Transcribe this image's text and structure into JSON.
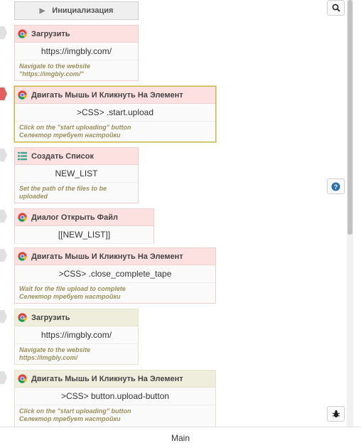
{
  "init_label": "Инициализация",
  "footer_tab": "Main",
  "blocks": [
    {
      "title": "Загрузить",
      "value": "https://imgbly.com/",
      "note": [
        "Navigate to the website",
        "\"https://imgbly.com/\""
      ]
    },
    {
      "title": "Двигать Мышь И Кликнуть На Элемент",
      "value": ">CSS> .start.upload",
      "note": [
        "Click on the \"start uploading\" button",
        "Селектор требует настройки"
      ]
    },
    {
      "title": "Создать Список",
      "value": "NEW_LIST",
      "note": [
        "Set the path of the files to be",
        "uploaded"
      ]
    },
    {
      "title": "Диалог Открыть Файл",
      "value": "[[NEW_LIST]]",
      "note": []
    },
    {
      "title": "Двигать Мышь И Кликнуть На Элемент",
      "value": ">CSS> .close_complete_tape",
      "note": [
        "Wait for the file upload to complete",
        "Селектор требует настройки"
      ]
    },
    {
      "title": "Загрузить",
      "value": "https://imgbly.com/",
      "note": [
        "Navigate to the website",
        "https://imgbly.com/"
      ]
    },
    {
      "title": "Двигать Мышь И Кликнуть На Элемент",
      "value": ">CSS> button.upload-button",
      "note": [
        "Click on the \"start uploading\" button",
        "Селектор требует настройки"
      ]
    }
  ],
  "icons": {
    "browser": "chrome-icon",
    "list": "list-icon",
    "search": "search-icon",
    "help": "help-icon",
    "debug": "bug-icon"
  },
  "colors": {
    "error_header": "#fde0e0",
    "ok_header": "#efeedd",
    "selected_border": "#c9b74a",
    "active_marker": "#e05f5f",
    "note_text": "#9a8f5a",
    "help_blue": "#2a6fb0"
  }
}
